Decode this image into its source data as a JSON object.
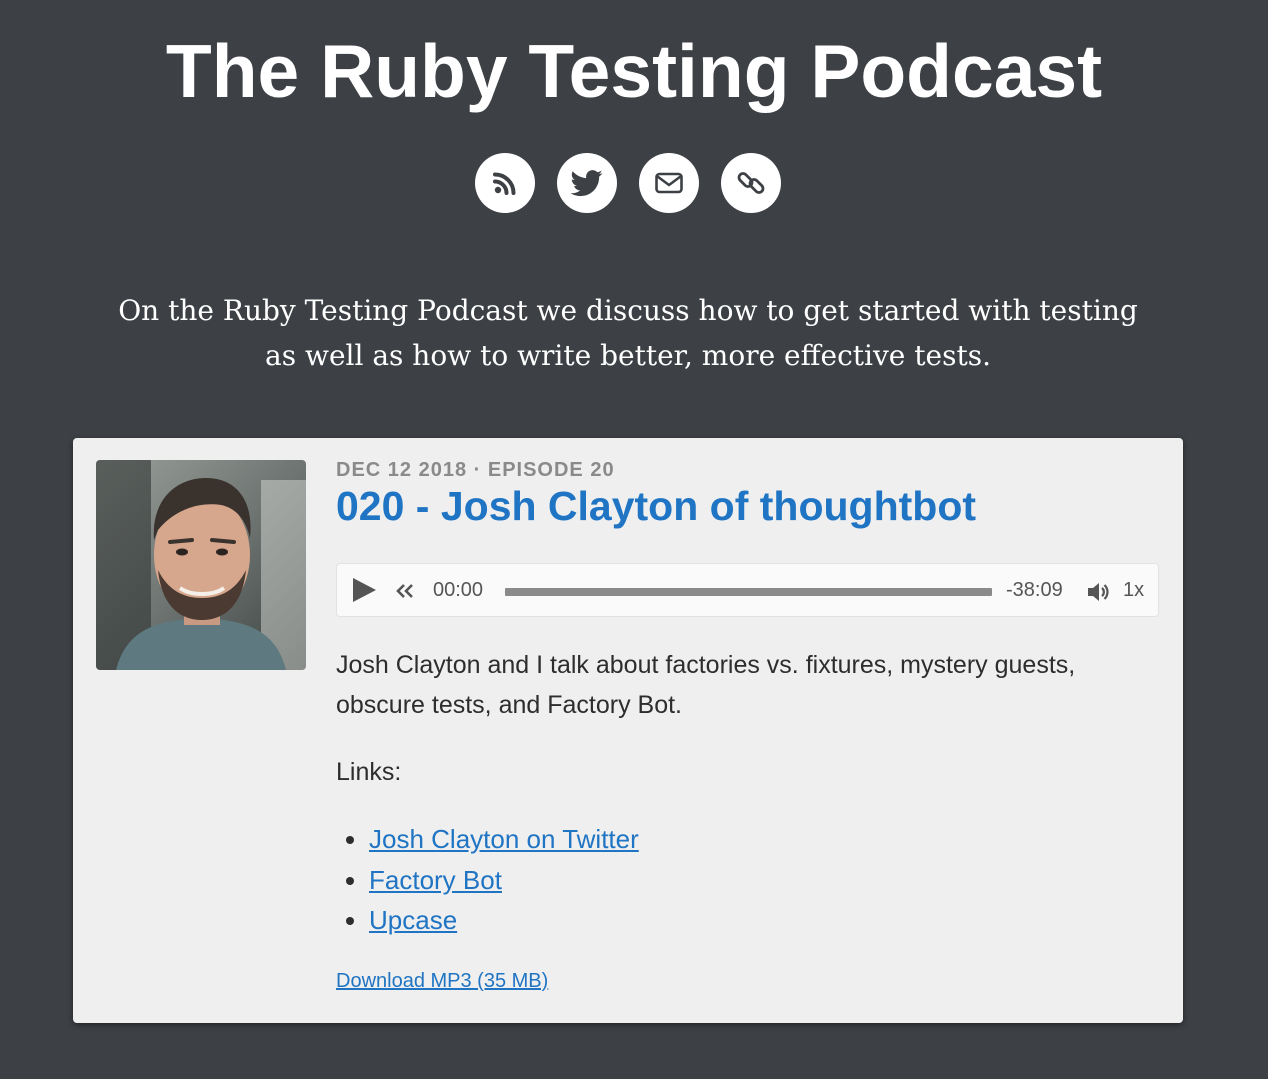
{
  "site": {
    "title": "The Ruby Testing Podcast",
    "tagline": "On the Ruby Testing Podcast we discuss how to get started with testing as well as how to write better, more effective tests."
  },
  "social": [
    {
      "name": "rss",
      "icon": "rss-icon"
    },
    {
      "name": "twitter",
      "icon": "twitter-icon"
    },
    {
      "name": "email",
      "icon": "envelope-icon"
    },
    {
      "name": "website",
      "icon": "link-icon"
    }
  ],
  "episode": {
    "meta": "DEC 12 2018 · EPISODE 20",
    "title": "020 - Josh Clayton of thoughtbot",
    "avatar_icon": "guest-photo",
    "player": {
      "current_time": "00:00",
      "remaining_time": "-38:09",
      "speed": "1x",
      "progress": 0
    },
    "description": "Josh Clayton and I talk about factories vs. fixtures, mystery guests, obscure tests, and Factory Bot.",
    "links_heading": "Links:",
    "links": [
      {
        "label": "Josh Clayton on Twitter"
      },
      {
        "label": "Factory Bot"
      },
      {
        "label": "Upcase"
      }
    ],
    "download_label": "Download MP3 (35 MB)"
  },
  "colors": {
    "background": "#3d4045",
    "card": "#efefef",
    "link": "#1f74c3",
    "meta": "#8a8a8a"
  }
}
